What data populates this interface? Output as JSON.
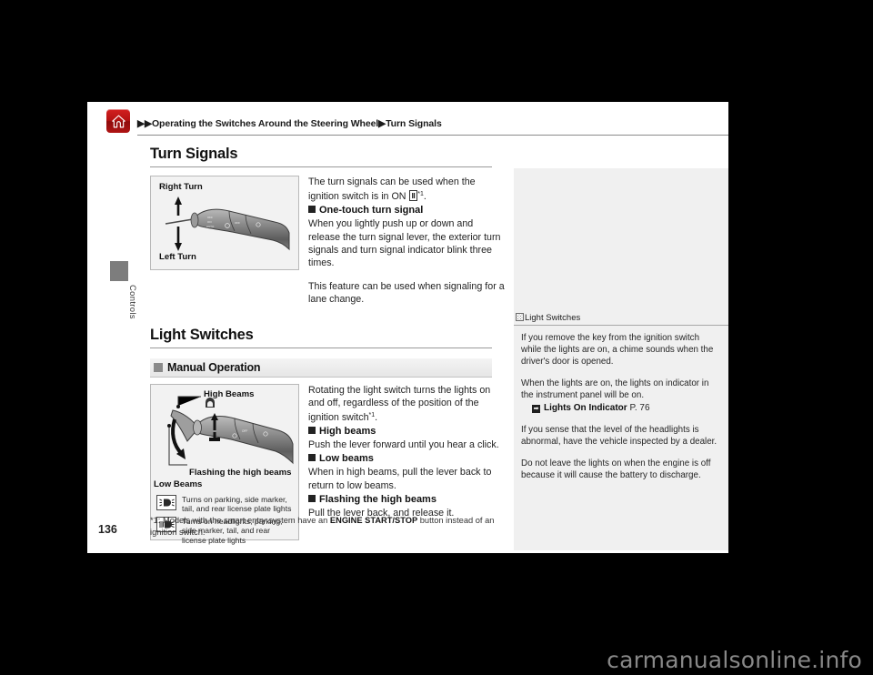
{
  "header": {
    "home_icon": "home-icon",
    "breadcrumb": "▶▶Operating the Switches Around the Steering Wheel▶Turn Signals"
  },
  "side_tab": {
    "label": "Controls"
  },
  "page_number": "136",
  "watermark": "carmanualsonline.info",
  "sections": [
    {
      "title": "Turn Signals",
      "figure": {
        "label_top": "Right Turn",
        "label_bottom": "Left Turn",
        "alt": "turn-signal-lever-illustration"
      },
      "intro": "The turn signals can be used when the ignition switch is in ON",
      "on_symbol": "II",
      "footnote_marker": "*1",
      "intro_tail": ".",
      "subheads": [
        {
          "head": "One-touch turn signal",
          "body": "When you lightly push up or down and release the turn signal lever, the exterior turn signals and turn signal indicator blink three times."
        }
      ],
      "closing": "This feature can be used when signaling for a lane change."
    },
    {
      "title": "Light Switches",
      "band_head": "Manual Operation",
      "figure": {
        "label_high_beams": "High Beams",
        "label_flashing": "Flashing the high beams",
        "label_low_beams": "Low Beams",
        "legend": [
          {
            "icon": "parking-lights-icon",
            "text": "Turns on parking, side marker, tail, and rear license plate lights"
          },
          {
            "icon": "headlights-icon",
            "text": "Turns on headlights, parking, side marker, tail, and rear license plate lights"
          }
        ]
      },
      "intro": "Rotating the light switch turns the lights on and off, regardless of the position of the ignition switch",
      "footnote_marker": "*1",
      "intro_tail": ".",
      "subheads": [
        {
          "head": "High beams",
          "body": "Push the lever forward until you hear a click."
        },
        {
          "head": "Low beams",
          "body": "When in high beams, pull the lever back to return to low beams."
        },
        {
          "head": "Flashing the high beams",
          "body": "Pull the lever back, and release it."
        }
      ]
    }
  ],
  "footnote": {
    "prefix": "*1: Models with the smart entry system have an ",
    "bold": "ENGINE START/STOP",
    "suffix": " button instead of an ignition switch."
  },
  "info_panel": {
    "heading": "Light Switches",
    "heading_icon": "hatched-square-icon",
    "paragraphs": [
      "If you remove the key from the ignition switch while the lights are on, a chime sounds when the driver's door is opened.",
      "When the lights are on, the lights on indicator in the instrument panel will be on."
    ],
    "xref": {
      "icon": "arrow-jump-icon",
      "label": "Lights On Indicator",
      "page": "P. 76"
    },
    "paragraphs_after": [
      "If you sense that the level of the headlights is abnormal, have the vehicle inspected by a dealer.",
      "Do not leave the lights on when the engine is off because it will cause the battery to discharge."
    ]
  },
  "colors": {
    "accent_red": "#b41212",
    "panel_gray": "#f0f0f0",
    "figure_gray": "#f2f2f2",
    "rule_gray": "#9a9a9a"
  }
}
